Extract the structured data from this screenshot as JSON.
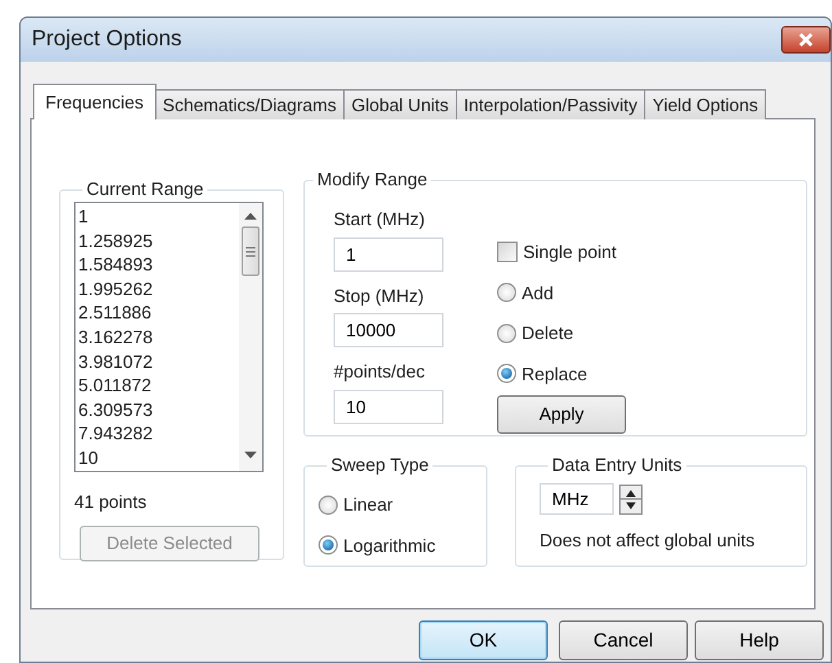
{
  "window": {
    "title": "Project Options"
  },
  "tabs": [
    {
      "label": "Frequencies",
      "selected": true
    },
    {
      "label": "Schematics/Diagrams",
      "selected": false
    },
    {
      "label": "Global Units",
      "selected": false
    },
    {
      "label": "Interpolation/Passivity",
      "selected": false
    },
    {
      "label": "Yield Options",
      "selected": false
    }
  ],
  "current_range": {
    "title": "Current Range",
    "items": [
      "1",
      "1.258925",
      "1.584893",
      "1.995262",
      "2.511886",
      "3.162278",
      "3.981072",
      "5.011872",
      "6.309573",
      "7.943282",
      "10"
    ],
    "count": "41 points",
    "delete_button": {
      "label": "Delete Selected",
      "disabled": true
    }
  },
  "modify_range": {
    "title": "Modify Range",
    "fields": [
      {
        "label": "Start (MHz)",
        "value": "1"
      },
      {
        "label": "Stop (MHz)",
        "value": "10000"
      },
      {
        "label": "#points/dec",
        "value": "10"
      }
    ],
    "single_point": {
      "label": "Single point",
      "checked": false
    },
    "actions": [
      {
        "label": "Add",
        "selected": false
      },
      {
        "label": "Delete",
        "selected": false
      },
      {
        "label": "Replace",
        "selected": true
      }
    ],
    "apply": "Apply"
  },
  "sweep_type": {
    "title": "Sweep Type",
    "options": [
      {
        "label": "Linear",
        "selected": false
      },
      {
        "label": "Logarithmic",
        "selected": true
      }
    ]
  },
  "data_entry_units": {
    "title": "Data Entry Units",
    "value": "MHz",
    "note": "Does not affect global units"
  },
  "buttons": [
    {
      "label": "OK",
      "default": true
    },
    {
      "label": "Cancel",
      "default": false
    },
    {
      "label": "Help",
      "default": false
    }
  ]
}
